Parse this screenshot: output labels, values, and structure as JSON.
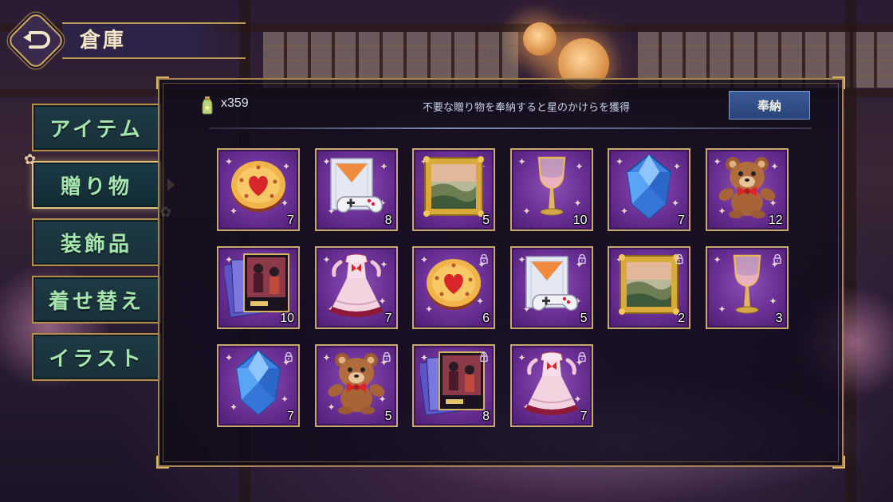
{
  "header": {
    "title": "倉庫",
    "back_icon": "back-arrow-icon"
  },
  "tabs": [
    {
      "label": "アイテム",
      "active": false
    },
    {
      "label": "贈り物",
      "active": true
    },
    {
      "label": "装飾品",
      "active": false
    },
    {
      "label": "着せ替え",
      "active": false
    },
    {
      "label": "イラスト",
      "active": false
    }
  ],
  "toolbar": {
    "currency_icon": "star-fragment-bottle-icon",
    "currency_count": "x359",
    "hint": "不要な贈り物を奉納すると星のかけらを獲得",
    "offer_label": "奉納"
  },
  "items": [
    {
      "icon": "heart-cookie-icon",
      "count": "7",
      "locked": false
    },
    {
      "icon": "game-console-icon",
      "count": "8",
      "locked": false
    },
    {
      "icon": "painting-icon",
      "count": "5",
      "locked": false
    },
    {
      "icon": "wine-glass-icon",
      "count": "10",
      "locked": false
    },
    {
      "icon": "blue-gem-icon",
      "count": "7",
      "locked": false
    },
    {
      "icon": "teddy-bear-icon",
      "count": "12",
      "locked": false
    },
    {
      "icon": "photo-cards-icon",
      "count": "10",
      "locked": false
    },
    {
      "icon": "frilly-dress-icon",
      "count": "7",
      "locked": false
    },
    {
      "icon": "heart-cookie-icon",
      "count": "6",
      "locked": true
    },
    {
      "icon": "game-console-icon",
      "count": "5",
      "locked": true
    },
    {
      "icon": "painting-icon",
      "count": "2",
      "locked": true
    },
    {
      "icon": "wine-glass-icon",
      "count": "3",
      "locked": true
    },
    {
      "icon": "blue-gem-icon",
      "count": "7",
      "locked": true
    },
    {
      "icon": "teddy-bear-icon",
      "count": "5",
      "locked": true
    },
    {
      "icon": "photo-cards-icon",
      "count": "8",
      "locked": true
    },
    {
      "icon": "frilly-dress-icon",
      "count": "7",
      "locked": true
    }
  ],
  "colors": {
    "tab_text": "#a6e6ae",
    "slot_purple": "#6a2f94",
    "gold_border": "#c7a86d",
    "offer_button": "#2f4c86"
  }
}
